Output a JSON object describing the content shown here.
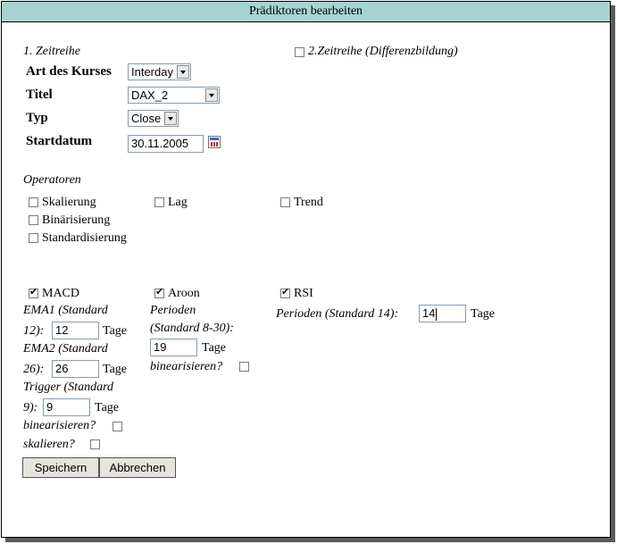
{
  "title": "Prädiktoren bearbeiten",
  "series1": {
    "heading": "1. Zeitreihe",
    "kurs_label": "Art des Kurses",
    "kurs_value": "Interday",
    "titel_label": "Titel",
    "titel_value": "DAX_2",
    "typ_label": "Typ",
    "typ_value": "Close",
    "startdatum_label": "Startdatum",
    "startdatum_value": "30.11.2005"
  },
  "series2": {
    "label": "2.Zeitreihe (Differenzbildung)",
    "checked": false
  },
  "operatoren": {
    "heading": "Operatoren",
    "skalierung": "Skalierung",
    "lag": "Lag",
    "trend": "Trend",
    "binarisierung": "Binärisierung",
    "standardisierung": "Standardisierung"
  },
  "macd": {
    "label": "MACD",
    "checked": true,
    "ema1_label_a": "EMA1 (Standard",
    "ema1_label_b": "12):",
    "ema1_value": "12",
    "ema2_label_a": "EMA2 (Standard",
    "ema2_label_b": "26):",
    "ema2_value": "26",
    "trigger_label_a": "Trigger (Standard",
    "trigger_label_b": "9):",
    "trigger_value": "9",
    "tage": "Tage",
    "binearisieren": "binearisieren?",
    "skalieren": "skalieren?"
  },
  "aroon": {
    "label": "Aroon",
    "checked": true,
    "perioden_a": "Perioden",
    "perioden_b": "(Standard 8-30):",
    "perioden_value": "19",
    "tage": "Tage",
    "binearisieren": "binearisieren?"
  },
  "rsi": {
    "label": "RSI",
    "checked": true,
    "perioden": "Perioden (Standard 14):",
    "perioden_value": "14",
    "tage": "Tage"
  },
  "buttons": {
    "save": "Speichern",
    "cancel": "Abbrechen"
  }
}
